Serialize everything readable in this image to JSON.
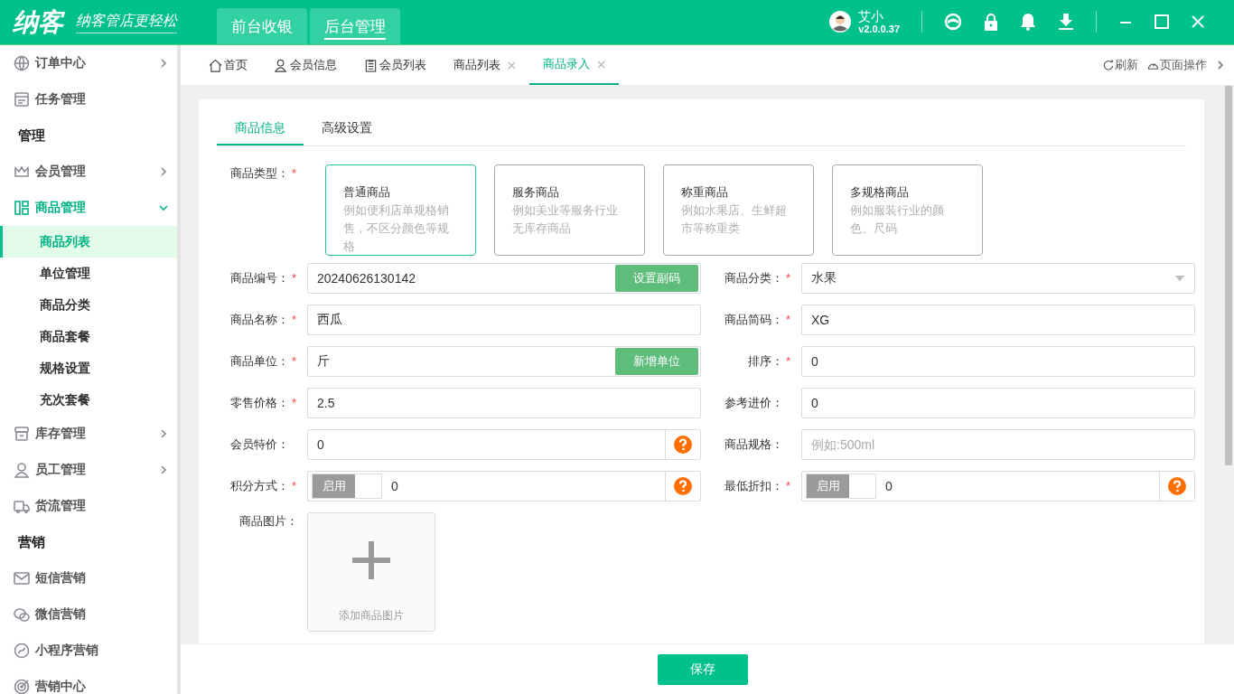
{
  "header": {
    "logo": "纳客",
    "slogan": "纳客管店更轻松",
    "tabs": [
      {
        "label": "前台收银",
        "selected": false
      },
      {
        "label": "后台管理",
        "selected": true
      }
    ],
    "user": {
      "name": "艾小",
      "version": "v2.0.0.37"
    }
  },
  "sidebar": {
    "items": [
      {
        "kind": "group",
        "label": "订单中心"
      },
      {
        "kind": "item",
        "label": "任务管理"
      },
      {
        "kind": "section",
        "label": "管理"
      },
      {
        "kind": "group",
        "label": "会员管理"
      },
      {
        "kind": "group",
        "label": "商品管理",
        "expanded": true,
        "children": [
          {
            "label": "商品列表",
            "selected": true
          },
          {
            "label": "单位管理",
            "selected": false
          },
          {
            "label": "商品分类",
            "selected": false
          },
          {
            "label": "商品套餐",
            "selected": false
          },
          {
            "label": "规格设置",
            "selected": false
          },
          {
            "label": "充次套餐",
            "selected": false
          }
        ]
      },
      {
        "kind": "group",
        "label": "库存管理"
      },
      {
        "kind": "group",
        "label": "员工管理"
      },
      {
        "kind": "item",
        "label": "货流管理"
      },
      {
        "kind": "section",
        "label": "营销"
      },
      {
        "kind": "item",
        "label": "短信营销"
      },
      {
        "kind": "item",
        "label": "微信营销"
      },
      {
        "kind": "item",
        "label": "小程序营销"
      },
      {
        "kind": "item",
        "label": "营销中心"
      }
    ]
  },
  "page_tabs": [
    {
      "label": "首页",
      "closable": false,
      "selected": false
    },
    {
      "label": "会员信息",
      "closable": false,
      "selected": false
    },
    {
      "label": "会员列表",
      "closable": false,
      "selected": false
    },
    {
      "label": "商品列表",
      "closable": true,
      "selected": false
    },
    {
      "label": "商品录入",
      "closable": true,
      "selected": true
    }
  ],
  "page_actions": [
    "刷新",
    "页面操作"
  ],
  "form_tabs": [
    {
      "label": "商品信息",
      "selected": true
    },
    {
      "label": "高级设置",
      "selected": false
    }
  ],
  "product_type": {
    "label": "商品类型：",
    "mark": "*",
    "options": [
      {
        "title": "普通商品",
        "description": "例如便利店单规格销售，不区分颜色等规格",
        "selected": true
      },
      {
        "title": "服务商品",
        "description": "例如美业等服务行业无库存商品",
        "selected": false
      },
      {
        "title": "称重商品",
        "description": "例如水果店、生鲜超市等称重类",
        "selected": false
      },
      {
        "title": "多规格商品",
        "description": "例如服装行业的颜色、尺码",
        "selected": false
      }
    ]
  },
  "fields": [
    {
      "kind": "button",
      "label": "商品编号：",
      "mark": "*",
      "value": "20240626130142",
      "button": "设置副码"
    },
    {
      "kind": "select",
      "label": "商品分类：",
      "mark": "*",
      "value": "水果"
    },
    {
      "kind": "text",
      "label": "商品名称：",
      "mark": "*",
      "value": "西瓜"
    },
    {
      "kind": "text",
      "label": "商品简码：",
      "mark": "*",
      "value": "XG"
    },
    {
      "kind": "button",
      "label": "商品单位：",
      "mark": "*",
      "value": "斤",
      "button": "新增单位"
    },
    {
      "kind": "text",
      "label": "排序：",
      "mark": "*",
      "value": "0"
    },
    {
      "kind": "text",
      "label": "零售价格：",
      "mark": "*",
      "value": "2.5"
    },
    {
      "kind": "text",
      "label": "参考进价：",
      "value": "0"
    },
    {
      "kind": "help",
      "label": "会员特价：",
      "value": "0"
    },
    {
      "kind": "text",
      "label": "商品规格：",
      "placeholder": "例如:500ml"
    },
    {
      "kind": "switch",
      "label": "积分方式：",
      "mark": "*",
      "switch_label": "启用",
      "on": false,
      "value": "0"
    },
    {
      "kind": "switch",
      "label": "最低折扣：",
      "mark": "*",
      "switch_label": "启用",
      "on": false,
      "value": "0"
    }
  ],
  "image_upload": {
    "label": "商品图片：",
    "hint": "添加商品图片"
  },
  "save_button": "保存"
}
